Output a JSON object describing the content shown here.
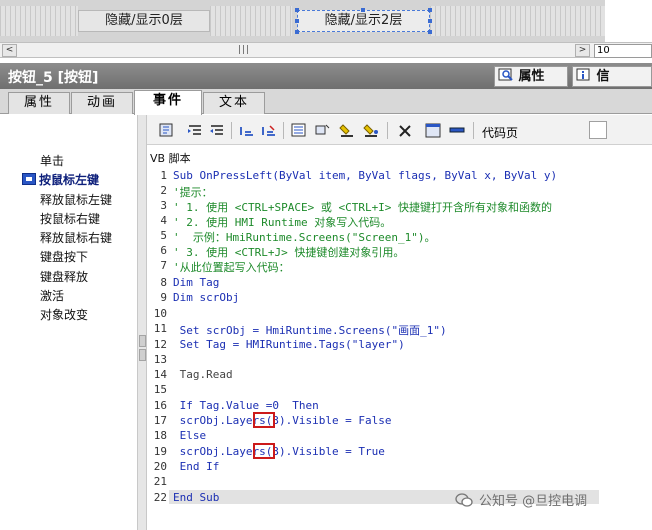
{
  "canvas": {
    "layer_buttons": [
      {
        "label": "隐藏/显示0层"
      },
      {
        "label": "隐藏/显示2层"
      }
    ]
  },
  "scrollbar": {
    "grip": "|||",
    "left_arrow": "<",
    "right_arrow": ">",
    "zoom_value": "10"
  },
  "inspector": {
    "title": "按钮_5 [按钮]",
    "properties_tab": "属性",
    "info_tab": "信"
  },
  "tabs": [
    {
      "label": "属性"
    },
    {
      "label": "动画"
    },
    {
      "label": "事件"
    },
    {
      "label": "文本"
    }
  ],
  "events": [
    {
      "label": "单击"
    },
    {
      "label": "按鼠标左键"
    },
    {
      "label": "释放鼠标左键"
    },
    {
      "label": "按鼠标右键"
    },
    {
      "label": "释放鼠标右键"
    },
    {
      "label": "键盘按下"
    },
    {
      "label": "键盘释放"
    },
    {
      "label": "激活"
    },
    {
      "label": "对象改变"
    }
  ],
  "toolbar": {
    "icons": [
      "script-insert-icon",
      "indent-icon",
      "outdent-icon",
      "comment-icon",
      "uncomment-icon",
      "object-list-icon",
      "tag-icon",
      "bookmark-icon",
      "bookmark-next-icon",
      "delete-icon",
      "dialog-icon",
      "minus-icon"
    ],
    "codepage_label": "代码页"
  },
  "script": {
    "label": "VB 脚本",
    "lines": [
      {
        "n": "1",
        "text": "Sub OnPressLeft(ByVal item, ByVal flags, ByVal x, ByVal y)"
      },
      {
        "n": "2",
        "text": "'提示："
      },
      {
        "n": "3",
        "text": "' 1. 使用 <CTRL+SPACE> 或 <CTRL+I> 快捷键打开含所有对象和函数的"
      },
      {
        "n": "4",
        "text": "' 2. 使用 HMI Runtime 对象写入代码。"
      },
      {
        "n": "5",
        "text": "'  示例：HmiRuntime.Screens(\"Screen_1\")。"
      },
      {
        "n": "6",
        "text": "' 3. 使用 <CTRL+J> 快捷键创建对象引用。"
      },
      {
        "n": "7",
        "text": "'从此位置起写入代码："
      },
      {
        "n": "8",
        "text": "Dim Tag"
      },
      {
        "n": "9",
        "text": "Dim scrObj"
      },
      {
        "n": "10",
        "text": ""
      },
      {
        "n": "11",
        "text": " Set scrObj = HmiRuntime.Screens(\"画面_1\")"
      },
      {
        "n": "12",
        "text": " Set Tag = HMIRuntime.Tags(\"layer\")"
      },
      {
        "n": "13",
        "text": ""
      },
      {
        "n": "14",
        "text": " Tag.Read"
      },
      {
        "n": "15",
        "text": ""
      },
      {
        "n": "16",
        "text": " If Tag.Value =0  Then"
      },
      {
        "n": "17",
        "text": " scrObj.Layers(3).Visible = False"
      },
      {
        "n": "18",
        "text": " Else"
      },
      {
        "n": "19",
        "text": " scrObj.Layers(3).Visible = True"
      },
      {
        "n": "20",
        "text": " End If"
      },
      {
        "n": "21",
        "text": ""
      },
      {
        "n": "22",
        "text": "End Sub"
      }
    ]
  },
  "watermark": {
    "text": "公知号 @旦控电调"
  }
}
